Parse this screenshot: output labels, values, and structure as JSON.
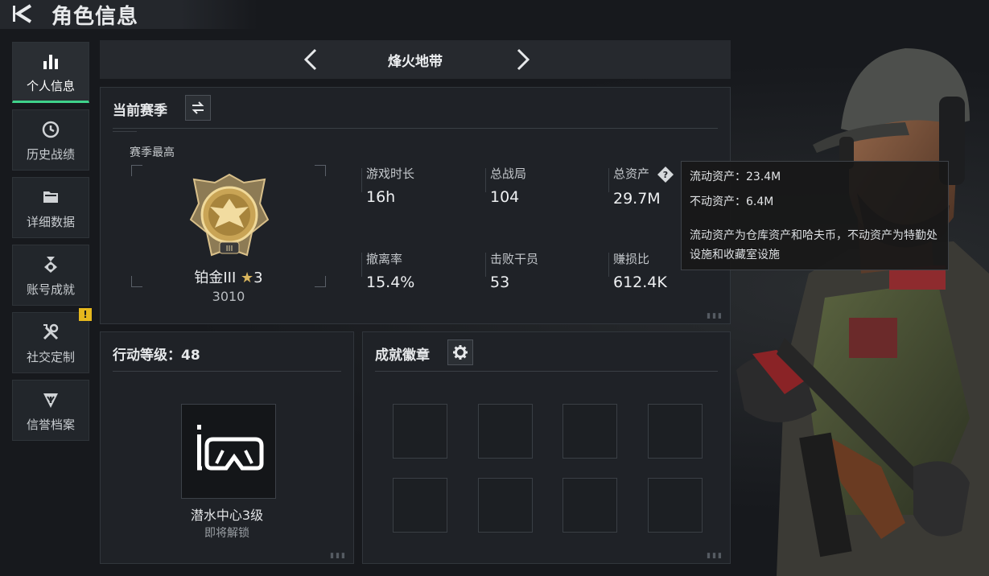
{
  "header": {
    "title": "角色信息",
    "back_icon": "back-arrow-icon"
  },
  "sidebar": {
    "items": [
      {
        "label": "个人信息",
        "icon": "bar-chart-icon",
        "active": true
      },
      {
        "label": "历史战绩",
        "icon": "clock-icon",
        "active": false
      },
      {
        "label": "详细数据",
        "icon": "folder-icon",
        "active": false
      },
      {
        "label": "账号成就",
        "icon": "medal-icon",
        "active": false
      },
      {
        "label": "社交定制",
        "icon": "tools-icon",
        "active": false,
        "badge": "!"
      },
      {
        "label": "信誉档案",
        "icon": "shield-icon",
        "active": false
      }
    ]
  },
  "mode": {
    "title": "烽火地带"
  },
  "season": {
    "title": "当前赛季",
    "subtitle": "赛季最高",
    "rank": {
      "name": "铂金III",
      "stars": "3",
      "score": "3010",
      "tier_mark": "III"
    },
    "stats": [
      {
        "label": "游戏时长",
        "value": "16h"
      },
      {
        "label": "总战局",
        "value": "104"
      },
      {
        "label": "总资产",
        "value": "29.7M"
      },
      {
        "label": "撤离率",
        "value": "15.4%"
      },
      {
        "label": "击败干员",
        "value": "53"
      },
      {
        "label": "赚损比",
        "value": "612.4K"
      }
    ]
  },
  "tooltip": {
    "liquid": "流动资产：23.4M",
    "fixed": "不动资产：6.4M",
    "desc": "流动资产为仓库资产和哈夫币，不动资产为特勤处设施和收藏室设施"
  },
  "level": {
    "title": "行动等级：48",
    "reward_name": "潜水中心3级",
    "reward_status": "即将解锁"
  },
  "achievements": {
    "title": "成就徽章",
    "slots": 8
  },
  "colors": {
    "accent": "#3fd28a",
    "warn": "#e6b81d",
    "gold": "#c9a455"
  }
}
